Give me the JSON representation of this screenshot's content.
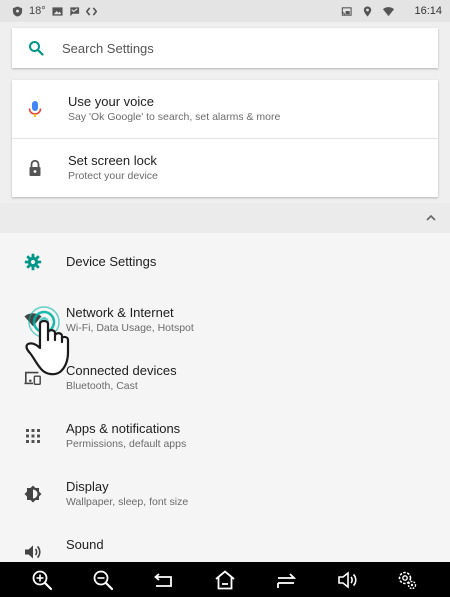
{
  "status_bar": {
    "temperature": "18°",
    "time": "16:14"
  },
  "search": {
    "placeholder": "Search Settings"
  },
  "suggestions": [
    {
      "title": "Use your voice",
      "subtitle": "Say 'Ok Google' to search, set alarms & more",
      "icon": "microphone-icon"
    },
    {
      "title": "Set screen lock",
      "subtitle": "Protect your device",
      "icon": "lock-icon"
    }
  ],
  "list": {
    "items": [
      {
        "title": "Device Settings",
        "subtitle": "",
        "icon": "gear-icon"
      },
      {
        "title": "Network & Internet",
        "subtitle": "Wi-Fi, Data Usage, Hotspot",
        "icon": "wifi-icon"
      },
      {
        "title": "Connected devices",
        "subtitle": "Bluetooth, Cast",
        "icon": "devices-icon"
      },
      {
        "title": "Apps & notifications",
        "subtitle": "Permissions, default apps",
        "icon": "apps-grid-icon"
      },
      {
        "title": "Display",
        "subtitle": "Wallpaper, sleep, font size",
        "icon": "brightness-icon"
      },
      {
        "title": "Sound",
        "subtitle": "",
        "icon": "volume-icon"
      }
    ]
  },
  "nav_bar": {
    "buttons": [
      "zoom-in-icon",
      "zoom-out-icon",
      "back-icon",
      "home-icon",
      "recents-icon",
      "volume-icon",
      "settings-icon"
    ]
  },
  "colors": {
    "accent": "#009688",
    "mic": "#4285f4",
    "nav_bg": "#000000"
  }
}
